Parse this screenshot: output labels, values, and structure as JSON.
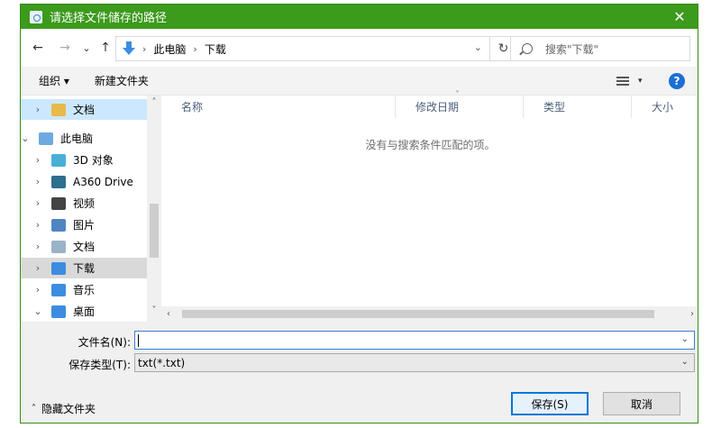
{
  "window": {
    "title": "请选择文件储存的路径",
    "close_label": "✕"
  },
  "nav": {
    "back_label": "←",
    "forward_label": "→",
    "recent_label": "⌄",
    "up_label": "↑",
    "address_path": [
      "此电脑",
      "下载"
    ],
    "address_sep": "›",
    "address_dropdown": "⌄",
    "refresh_label": "↻",
    "search_placeholder": "搜索\"下载\""
  },
  "toolbar": {
    "organize_label": "组织 ▾",
    "new_folder_label": "新建文件夹",
    "views_caret": "▾",
    "help_label": "?"
  },
  "sidebar": {
    "items": [
      {
        "label": "文档",
        "chevron": "›",
        "icon": "document-folder-icon",
        "color": "#e9b949"
      },
      {
        "label": "此电脑",
        "chevron": "⌄",
        "icon": "computer-icon",
        "color": "#6ea9e0"
      },
      {
        "label": "3D 对象",
        "chevron": "›",
        "icon": "3d-objects-icon",
        "color": "#48b0d8"
      },
      {
        "label": "A360 Drive",
        "chevron": "›",
        "icon": "a360-drive-icon",
        "color": "#2c6f8f"
      },
      {
        "label": "视频",
        "chevron": "›",
        "icon": "video-icon",
        "color": "#444444"
      },
      {
        "label": "图片",
        "chevron": "›",
        "icon": "pictures-icon",
        "color": "#4f86c2"
      },
      {
        "label": "文档",
        "chevron": "›",
        "icon": "documents-icon",
        "color": "#9ab3c8"
      },
      {
        "label": "下载",
        "chevron": "›",
        "icon": "downloads-icon",
        "color": "#3c8de0"
      },
      {
        "label": "音乐",
        "chevron": "›",
        "icon": "music-icon",
        "color": "#3c8de0"
      },
      {
        "label": "桌面",
        "chevron": "⌄",
        "icon": "desktop-icon",
        "color": "#3c8de0"
      }
    ],
    "scroll_up": "˄",
    "scroll_down": "˅"
  },
  "content": {
    "columns": [
      "名称",
      "修改日期",
      "类型",
      "大小"
    ],
    "sort_indicator": "˅",
    "empty_message": "没有与搜索条件匹配的项。",
    "scroll_left": "‹",
    "scroll_right": "›"
  },
  "form": {
    "filename_label": "文件名(N):",
    "filename_value": "",
    "filetype_label": "保存类型(T):",
    "filetype_value": "txt(*.txt)",
    "dropdown_glyph": "⌄"
  },
  "footer": {
    "hide_folders_label": "隐藏文件夹",
    "hide_folders_caret": "˄",
    "save_label": "保存(S)",
    "cancel_label": "取消"
  },
  "colors": {
    "titlebar": "#3c9a1c",
    "selection": "#cce8ff",
    "accent": "#0078d7"
  }
}
